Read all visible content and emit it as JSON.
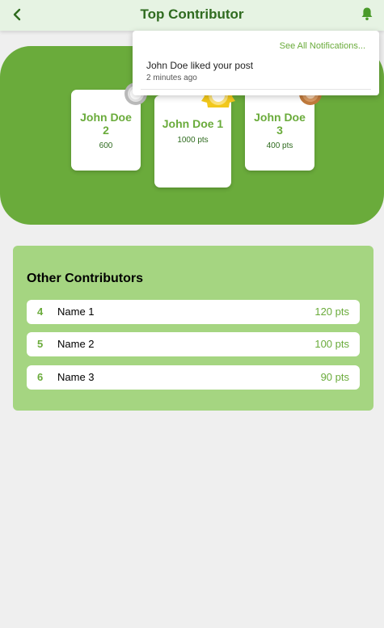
{
  "header": {
    "title": "Top Contributor"
  },
  "notifications": {
    "see_all_label": "See All Notifications...",
    "items": [
      {
        "message": "John Doe liked your post",
        "time": "2 minutes ago"
      }
    ]
  },
  "podium": {
    "first": {
      "name": "John Doe 1",
      "points": "1000 pts",
      "medal": "gold"
    },
    "second": {
      "name": "John Doe 2",
      "points": "600",
      "medal": "silver"
    },
    "third": {
      "name": "John Doe 3",
      "points": "400 pts",
      "medal": "bronze"
    }
  },
  "others": {
    "title": "Other Contributors",
    "rows": [
      {
        "rank": "4",
        "name": "Name 1",
        "points": "120 pts"
      },
      {
        "rank": "5",
        "name": "Name 2",
        "points": "100 pts"
      },
      {
        "rank": "6",
        "name": "Name 3",
        "points": "90 pts"
      }
    ]
  },
  "colors": {
    "accent": "#6aab3b",
    "header_bg": "#e6f3e3",
    "header_text": "#2f6b1f",
    "others_bg": "#a5d581",
    "page_bg": "#efefef"
  },
  "icons": {
    "back": "chevron-left-icon",
    "notifications": "bell-icon",
    "medals": [
      "silver-medal-icon",
      "gold-medal-icon",
      "bronze-medal-icon"
    ]
  }
}
